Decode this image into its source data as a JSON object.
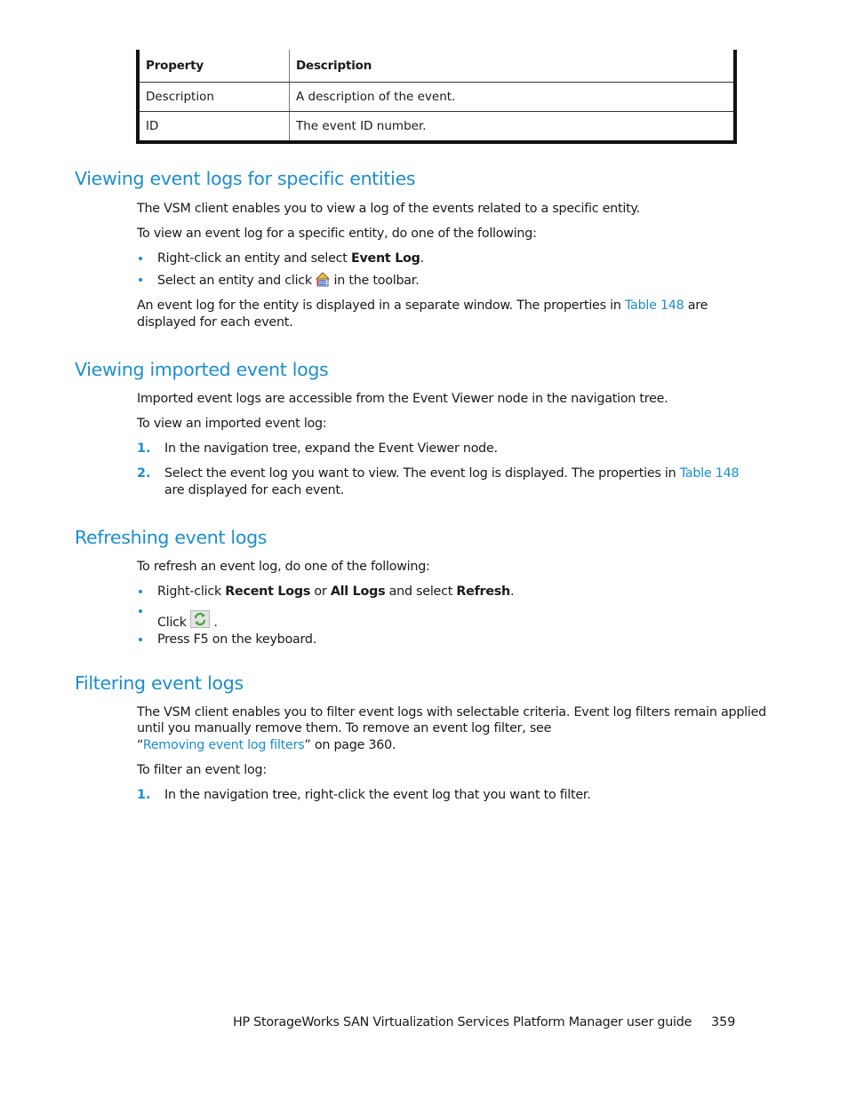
{
  "table": {
    "headers": [
      "Property",
      "Description"
    ],
    "rows": [
      {
        "property": "Description",
        "description": "A description of the event."
      },
      {
        "property": "ID",
        "description": "The event ID number."
      }
    ]
  },
  "sections": {
    "entities": {
      "heading": "Viewing event logs for specific entities",
      "intro": "The VSM client enables you to view a log of the events related to a specific entity.",
      "lead": "To view an event log for a specific entity, do one of the following:",
      "bullet1_pre": "Right-click an entity and select ",
      "bullet1_bold": "Event Log",
      "bullet1_post": ".",
      "bullet2_pre": "Select an entity and click ",
      "bullet2_icon": "event-log-icon",
      "bullet2_post": " in the toolbar.",
      "result_pre": "An event log for the entity is displayed in a separate window. The properties in ",
      "result_link": "Table 148",
      "result_post": " are",
      "result_line2": "displayed for each event."
    },
    "imported": {
      "heading": "Viewing imported event logs",
      "intro": "Imported event logs are accessible from the Event Viewer node in the navigation tree.",
      "lead": "To view an imported event log:",
      "step1_num": "1.",
      "step1": "In the navigation tree, expand the Event Viewer node.",
      "step2_num": "2.",
      "step2_pre": "Select the event log you want to view. The event log is displayed. The properties in ",
      "step2_link": "Table 148",
      "step2_line2": "are displayed for each event."
    },
    "refreshing": {
      "heading": "Refreshing event logs",
      "lead": "To refresh an event log, do one of the following:",
      "bullet1_pre": "Right-click ",
      "bullet1_bold1": "Recent Logs",
      "bullet1_mid1": " or ",
      "bullet1_bold2": "All Logs",
      "bullet1_mid2": " and select ",
      "bullet1_bold3": "Refresh",
      "bullet1_post": ".",
      "bullet2_pre": "Click ",
      "bullet2_icon": "refresh-icon",
      "bullet2_post": " .",
      "bullet3": "Press F5 on the keyboard."
    },
    "filtering": {
      "heading": "Filtering event logs",
      "intro_line1": "The VSM client enables you to filter event logs with selectable criteria. Event log filters remain applied",
      "intro_line2": "until you manually remove them. To remove an event log filter, see",
      "intro_q_open": "“",
      "intro_link": "Removing event log filters",
      "intro_post": "” on page 360.",
      "lead": "To filter an event log:",
      "step1_num": "1.",
      "step1": "In the navigation tree, right-click the event log that you want to filter."
    }
  },
  "footer": {
    "title": "HP StorageWorks SAN Virtualization Services Platform Manager user guide",
    "page_number": "359"
  },
  "colors": {
    "accent": "#1a8ed0",
    "text": "#1a1a1a"
  }
}
